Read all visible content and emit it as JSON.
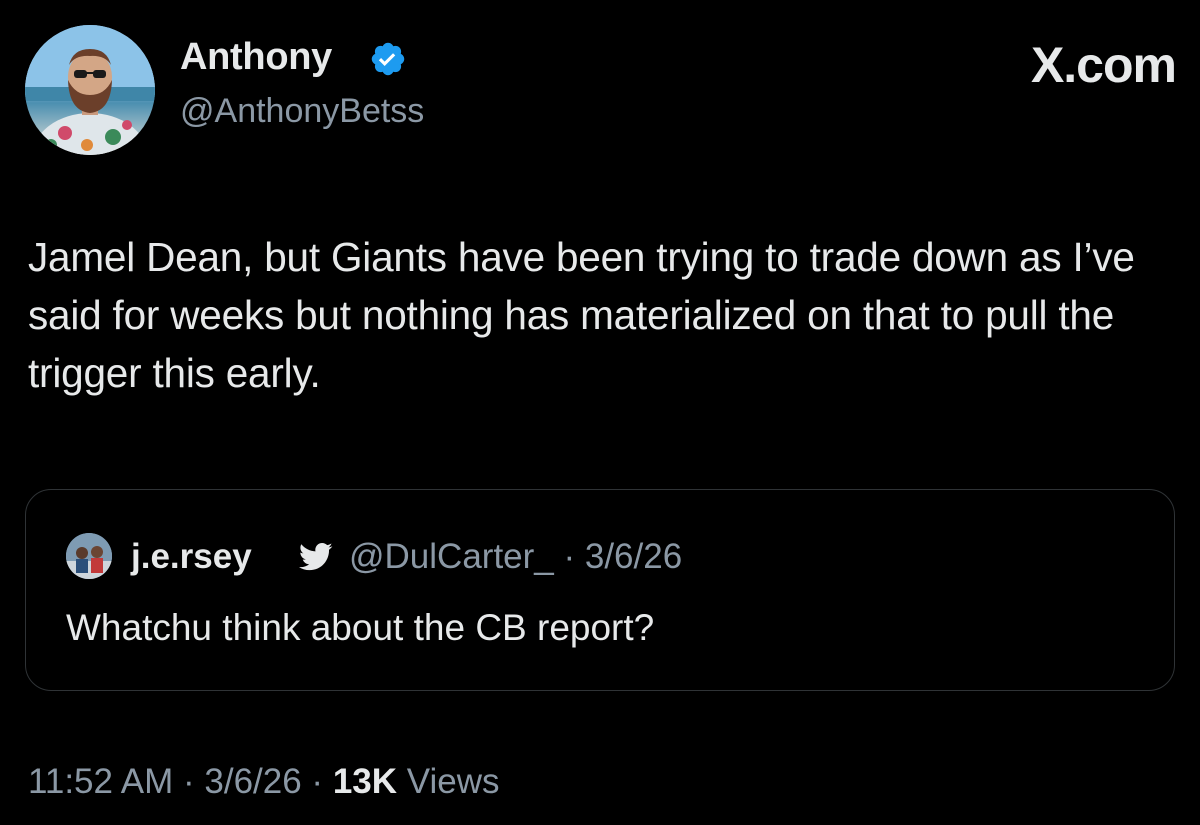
{
  "author": {
    "name": "Anthony",
    "handle": "@AnthonyBetss",
    "verified": true,
    "avatar_icon": "profile-photo"
  },
  "brand": {
    "label": "X.com"
  },
  "tweet": {
    "text": "Jamel Dean, but Giants have been trying to trade down as I’ve said for weeks but nothing has materialized on that to pull the trigger this early."
  },
  "quoted": {
    "name": "j.e.rsey",
    "badge_icon": "twitter-bird-icon",
    "handle_date": "@DulCarter_ · 3/6/26",
    "text": "Whatchu think about the CB report?"
  },
  "footer": {
    "time_date": "11:52 AM · 3/6/26 · ",
    "views_count": "13K",
    "views_label": " Views"
  },
  "colors": {
    "background": "#000000",
    "primary_text": "#e7e9ea",
    "secondary_text": "#8b98a5",
    "verified_blue": "#1d9bf0",
    "border": "#2f3336"
  }
}
